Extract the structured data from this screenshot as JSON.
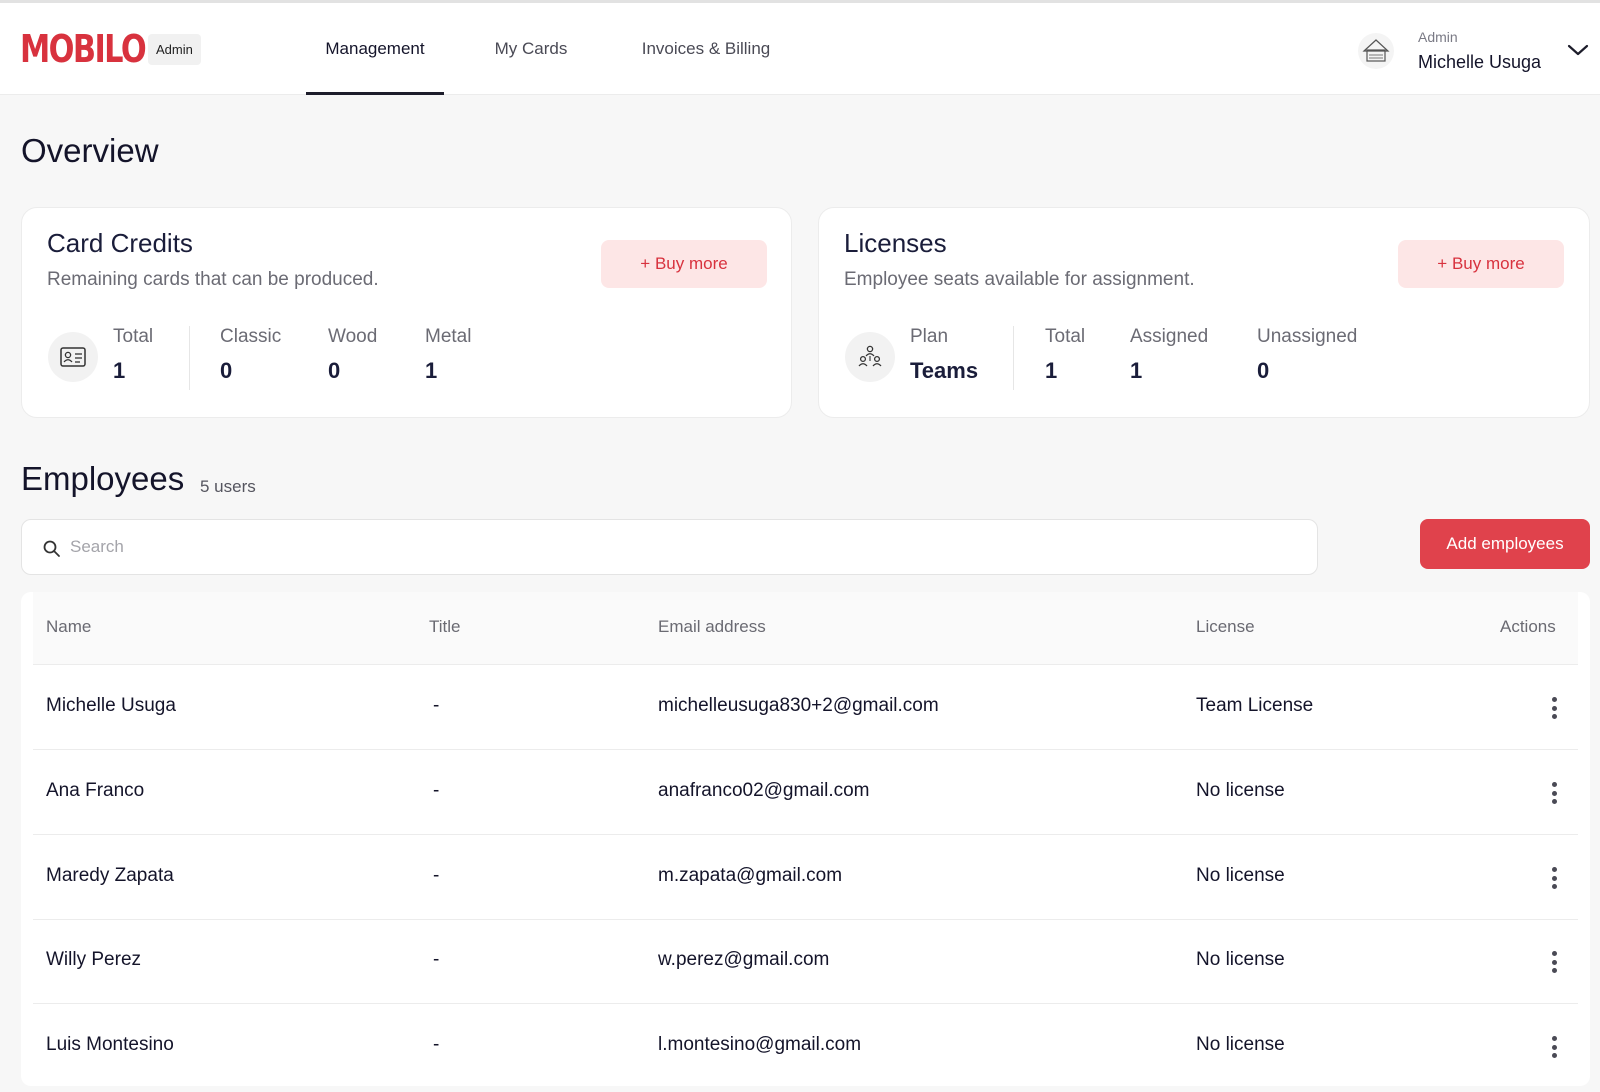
{
  "header": {
    "logo": "MOBILO",
    "badge": "Admin",
    "tabs": [
      {
        "label": "Management",
        "active": true
      },
      {
        "label": "My Cards",
        "active": false
      },
      {
        "label": "Invoices & Billing",
        "active": false
      }
    ],
    "user": {
      "role": "Admin",
      "name": "Michelle Usuga"
    }
  },
  "overview": {
    "title": "Overview",
    "card_credits": {
      "title": "Card Credits",
      "subtitle": "Remaining cards that can be produced.",
      "buy_label": "+ Buy more",
      "icon": "id-card-icon",
      "stats": [
        {
          "label": "Total",
          "value": "1"
        },
        {
          "label": "Classic",
          "value": "0"
        },
        {
          "label": "Wood",
          "value": "0"
        },
        {
          "label": "Metal",
          "value": "1"
        }
      ]
    },
    "licenses": {
      "title": "Licenses",
      "subtitle": "Employee seats available for assignment.",
      "buy_label": "+ Buy more",
      "icon": "team-icon",
      "plan_label": "Plan",
      "plan_value": "Teams",
      "stats": [
        {
          "label": "Total",
          "value": "1"
        },
        {
          "label": "Assigned",
          "value": "1"
        },
        {
          "label": "Unassigned",
          "value": "0"
        }
      ]
    }
  },
  "employees": {
    "title": "Employees",
    "count": "5 users",
    "search_placeholder": "Search",
    "add_label": "Add employees",
    "columns": [
      "Name",
      "Title",
      "Email address",
      "License",
      "Actions"
    ],
    "rows": [
      {
        "name": "Michelle Usuga",
        "title": "-",
        "email": "michelleusuga830+2@gmail.com",
        "license": "Team License"
      },
      {
        "name": "Ana Franco",
        "title": "-",
        "email": "anafranco02@gmail.com",
        "license": "No license"
      },
      {
        "name": "Maredy Zapata",
        "title": "-",
        "email": "m.zapata@gmail.com",
        "license": "No license"
      },
      {
        "name": "Willy Perez",
        "title": "-",
        "email": "w.perez@gmail.com",
        "license": "No license"
      },
      {
        "name": "Luis Montesino",
        "title": "-",
        "email": "l.montesino@gmail.com",
        "license": "No license"
      }
    ]
  },
  "colors": {
    "brand": "#d8323e",
    "button": "#e0424c",
    "buy_bg": "#fde6e6"
  }
}
